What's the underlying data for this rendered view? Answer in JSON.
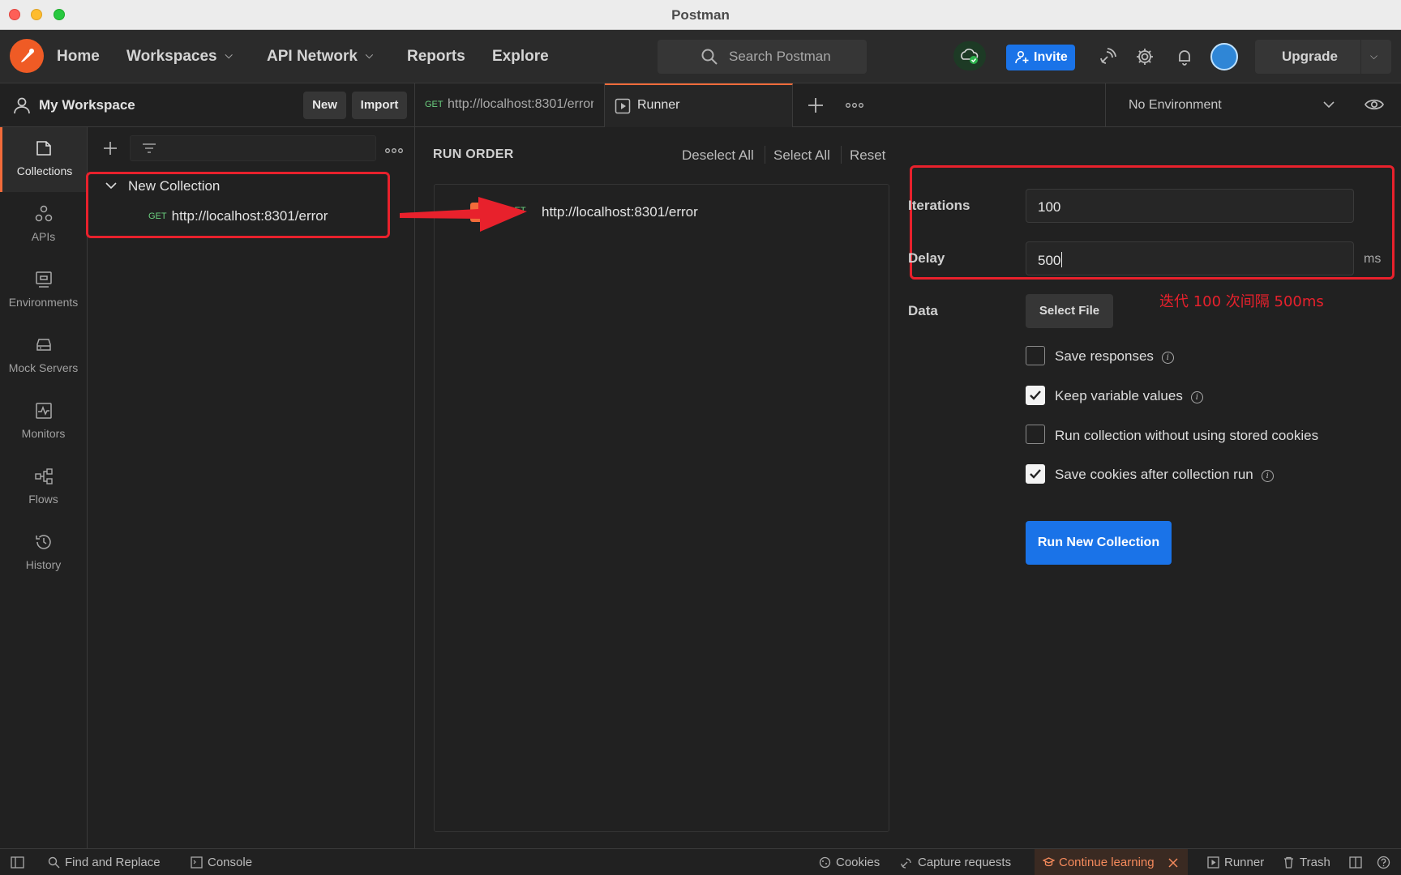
{
  "window": {
    "title": "Postman"
  },
  "header": {
    "nav": [
      "Home",
      "Workspaces",
      "API Network",
      "Reports",
      "Explore"
    ],
    "search_placeholder": "Search Postman",
    "invite_label": "Invite",
    "upgrade_label": "Upgrade"
  },
  "workspace": {
    "name": "My Workspace",
    "new_label": "New",
    "import_label": "Import"
  },
  "tabs": [
    {
      "method": "GET",
      "label": "http://localhost:8301/error"
    },
    {
      "label": "Runner"
    }
  ],
  "environment": {
    "selected": "No Environment"
  },
  "rail": {
    "items": [
      "Collections",
      "APIs",
      "Environments",
      "Mock Servers",
      "Monitors",
      "Flows",
      "History"
    ]
  },
  "collections": {
    "name": "New Collection",
    "request": {
      "method": "GET",
      "url": "http://localhost:8301/error"
    }
  },
  "runner": {
    "title": "RUN ORDER",
    "deselect_all": "Deselect All",
    "select_all": "Select All",
    "reset": "Reset",
    "item": {
      "method": "GET",
      "url": "http://localhost:8301/error"
    },
    "iterations_label": "Iterations",
    "iterations_value": "100",
    "delay_label": "Delay",
    "delay_value": "500",
    "delay_unit": "ms",
    "data_label": "Data",
    "select_file": "Select File",
    "annotation": "迭代 100 次间隔 500ms",
    "options": [
      {
        "label": "Save responses",
        "checked": false,
        "info": true
      },
      {
        "label": "Keep variable values",
        "checked": true,
        "info": true
      },
      {
        "label": "Run collection without using stored cookies",
        "checked": false,
        "info": false
      },
      {
        "label": "Save cookies after collection run",
        "checked": true,
        "info": true
      }
    ],
    "run_button": "Run New Collection"
  },
  "statusbar": {
    "find_replace": "Find and Replace",
    "console": "Console",
    "cookies": "Cookies",
    "capture": "Capture requests",
    "learning": "Continue learning",
    "runner": "Runner",
    "trash": "Trash"
  },
  "colors": {
    "accent": "#f26b3a",
    "primary_button": "#1a73e8",
    "annotation_red": "#e8212c",
    "get_method": "#6bcf7f"
  }
}
